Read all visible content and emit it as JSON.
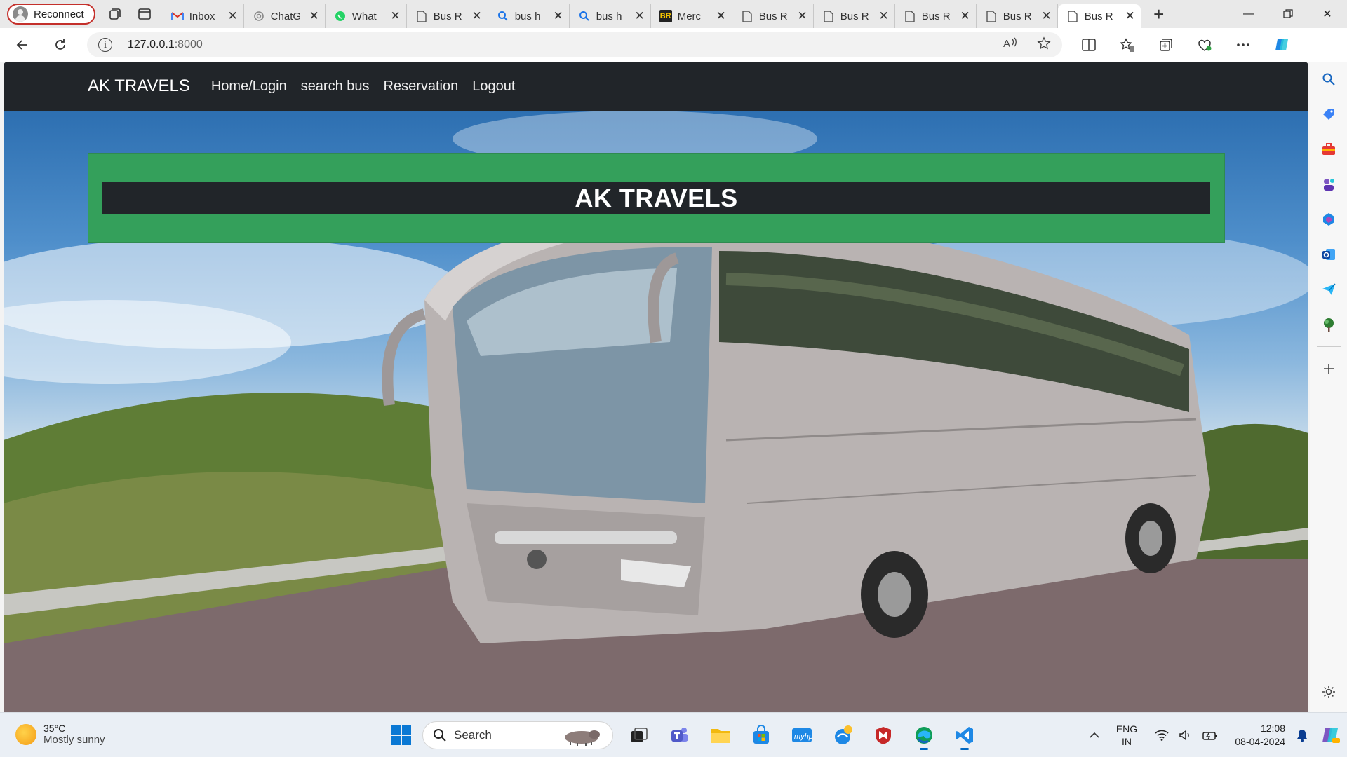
{
  "browser": {
    "profile_label": "Reconnect",
    "tabs": [
      {
        "title": "Inbox",
        "icon": "gmail-icon"
      },
      {
        "title": "ChatG",
        "icon": "chatgpt-icon"
      },
      {
        "title": "What",
        "icon": "whatsapp-icon"
      },
      {
        "title": "Bus R",
        "icon": "page-icon"
      },
      {
        "title": "bus h",
        "icon": "search-icon"
      },
      {
        "title": "bus h",
        "icon": "search-icon"
      },
      {
        "title": "Merc",
        "icon": "br-icon"
      },
      {
        "title": "Bus R",
        "icon": "page-icon"
      },
      {
        "title": "Bus R",
        "icon": "page-icon"
      },
      {
        "title": "Bus R",
        "icon": "page-icon"
      },
      {
        "title": "Bus R",
        "icon": "page-icon"
      },
      {
        "title": "Bus R",
        "icon": "page-icon",
        "active": true
      }
    ],
    "url_host": "127.0.0.1",
    "url_port": ":8000"
  },
  "site": {
    "brand": "AK TRAVELS",
    "nav": [
      "Home/Login",
      "search bus",
      "Reservation",
      "Logout"
    ],
    "banner_title": "AK TRAVELS"
  },
  "taskbar": {
    "temperature": "35°C",
    "weather": "Mostly sunny",
    "search_placeholder": "Search",
    "lang_line1": "ENG",
    "lang_line2": "IN",
    "time": "12:08",
    "date": "08-04-2024"
  },
  "colors": {
    "nav_bg": "#212529",
    "banner_green": "#34a05b",
    "accent_blue": "#0067c0"
  }
}
